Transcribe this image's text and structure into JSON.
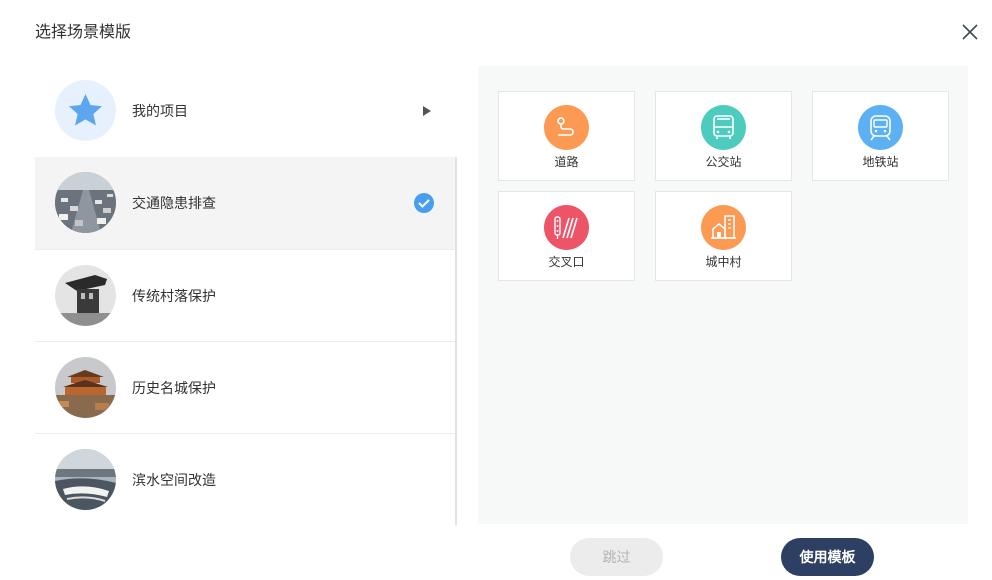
{
  "dialog": {
    "title": "选择场景模版",
    "close_icon": "close-icon"
  },
  "left_list": {
    "items": [
      {
        "label": "我的项目",
        "icon": "star-icon",
        "trailing": "caret-right-icon"
      },
      {
        "label": "交通隐患排查",
        "icon": "traffic-photo",
        "selected": true,
        "trailing": "check-circle-icon"
      },
      {
        "label": "传统村落保护",
        "icon": "village-photo"
      },
      {
        "label": "历史名城保护",
        "icon": "historic-city-photo"
      },
      {
        "label": "滨水空间改造",
        "icon": "waterfront-photo"
      }
    ]
  },
  "templates": {
    "cards": [
      {
        "label": "道路",
        "icon": "road-icon",
        "color": "#fc9a54"
      },
      {
        "label": "公交站",
        "icon": "bus-icon",
        "color": "#4ecbbf"
      },
      {
        "label": "地铁站",
        "icon": "metro-icon",
        "color": "#5cb0f4"
      },
      {
        "label": "交叉口",
        "icon": "traffic-light-icon",
        "color": "#ee5468"
      },
      {
        "label": "城中村",
        "icon": "urban-village-icon",
        "color": "#fc9a54"
      }
    ]
  },
  "footer": {
    "skip_label": "跳过",
    "use_label": "使用模板"
  },
  "colors": {
    "primary_button": "#2d4063",
    "check_blue": "#4a9eef",
    "star_blue": "#5ca5ef"
  }
}
